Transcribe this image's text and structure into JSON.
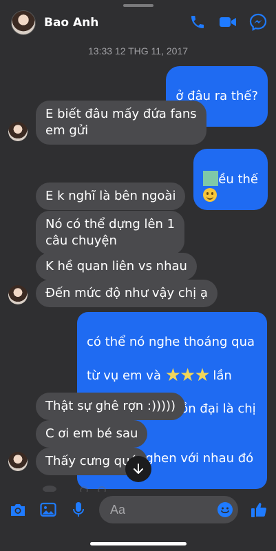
{
  "header": {
    "contact_name": "Bao Anh",
    "icons": [
      "phone-icon",
      "video-icon",
      "messenger-icon"
    ],
    "accent": "#1f6bf2"
  },
  "timestamp": "13:33 12 THG 11, 2017",
  "messages": [
    {
      "id": "m1",
      "from": "me",
      "text": "ở đâu ra thế?",
      "emoji": "smile"
    },
    {
      "id": "m2",
      "from": "them",
      "text": "E biết đâu mấy đứa fans\nem gửi"
    },
    {
      "id": "m3",
      "from": "me",
      "text": "ều thế",
      "redacted_prefix": true,
      "emoji": "smile"
    },
    {
      "id": "m4",
      "from": "them",
      "text": "E k nghĩ là bên ngoài"
    },
    {
      "id": "m5",
      "from": "them",
      "text": "Nó có thể dựng lên 1\ncâu chuyện"
    },
    {
      "id": "m6",
      "from": "them",
      "text": "K hề quan liên vs nhau"
    },
    {
      "id": "m7",
      "from": "them",
      "text": "Đến mức độ như vậy chị ạ"
    },
    {
      "id": "m8",
      "from": "me",
      "line1": "có thể nó nghe thoáng qua",
      "line2a": "từ vụ em và",
      "stars": "★★★",
      "line2b": "lần",
      "line3": "trước mà còn đồn đại là chị &",
      "line4": "em đánh ghen với nhau đó"
    },
    {
      "id": "m9",
      "from": "them",
      "text": "Thật sự ghê rợn :)))))"
    },
    {
      "id": "m10",
      "from": "them",
      "text": "C ơi em bé sau"
    },
    {
      "id": "m11",
      "from": "them",
      "text": "Thấy cưng quá"
    }
  ],
  "composer": {
    "placeholder": "Aa",
    "icons": [
      "camera-icon",
      "photo-icon",
      "microphone-icon",
      "emoji-icon",
      "like-icon"
    ]
  },
  "colors": {
    "background": "#2f2f31",
    "incoming_bubble": "#4a4a4d",
    "outgoing_bubble": "#1f6bf2"
  }
}
